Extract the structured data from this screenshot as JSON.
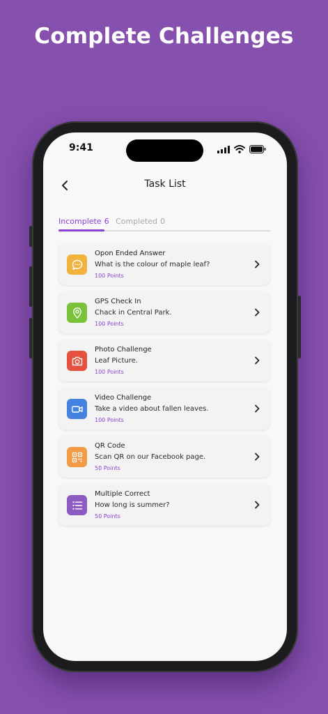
{
  "headline": "Complete Challenges",
  "status_bar": {
    "time": "9:41"
  },
  "nav": {
    "title": "Task List"
  },
  "tabs": [
    {
      "label": "Incomplete",
      "count": "6",
      "active": true
    },
    {
      "label": "Completed",
      "count": "0",
      "active": false
    }
  ],
  "tasks": [
    {
      "title": "Opon Ended Answer",
      "description": "What is the colour of maple leaf?",
      "points": "100 Points",
      "icon": "speech-bubble-icon",
      "color": "#f2b23e"
    },
    {
      "title": "GPS Check In",
      "description": "Chack in Central Park.",
      "points": "100 Points",
      "icon": "map-pin-icon",
      "color": "#79c23a"
    },
    {
      "title": "Photo Challenge",
      "description": "Leaf Picture.",
      "points": "100 Points",
      "icon": "camera-icon",
      "color": "#e5503f"
    },
    {
      "title": "Video Challenge",
      "description": "Take a video about fallen leaves.",
      "points": "100 Points",
      "icon": "video-camera-icon",
      "color": "#4582e0"
    },
    {
      "title": "QR Code",
      "description": "Scan QR on our Facebook page.",
      "points": "50 Points",
      "icon": "qr-code-icon",
      "color": "#f29a46"
    },
    {
      "title": "Multiple Correct",
      "description": "How long is summer?",
      "points": "50 Points",
      "icon": "checklist-icon",
      "color": "#8d5bc2"
    }
  ],
  "colors": {
    "background": "#8650ae",
    "accent": "#8a3fd1",
    "inactive_tab": "#a8a8a8"
  }
}
